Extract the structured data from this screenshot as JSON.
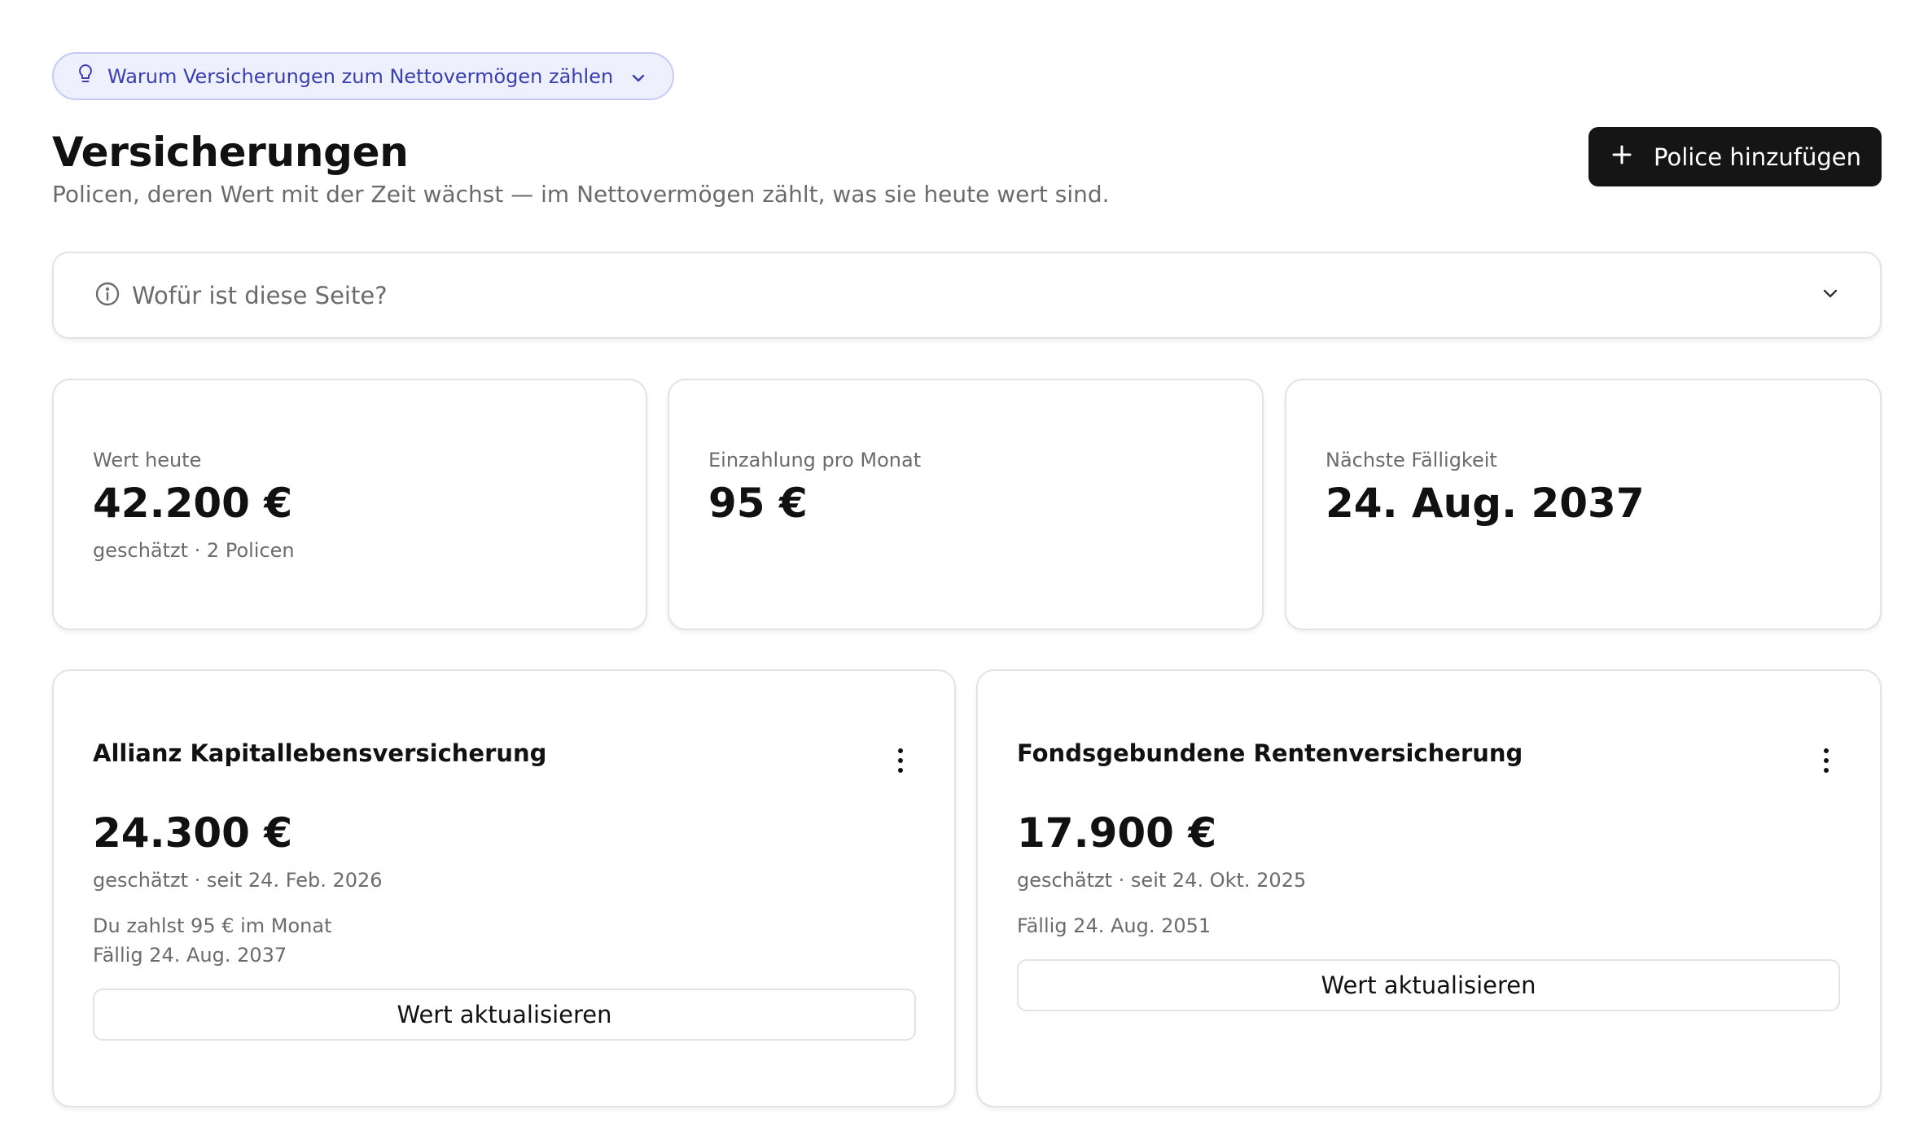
{
  "hint": {
    "label": "Warum Versicherungen zum Nettovermögen zählen",
    "icon": "lightbulb-icon"
  },
  "header": {
    "title": "Versicherungen",
    "subtitle": "Policen, deren Wert mit der Zeit wächst — im Nettovermögen zählt, was sie heute wert sind.",
    "add_button_label": "Police hinzufügen"
  },
  "info": {
    "question": "Wofür ist diese Seite?"
  },
  "stats": [
    {
      "label": "Wert heute",
      "value": "42.200 €",
      "sub": "geschätzt · 2 Policen"
    },
    {
      "label": "Einzahlung pro Monat",
      "value": "95 €",
      "sub": ""
    },
    {
      "label": "Nächste Fälligkeit",
      "value": "24. Aug. 2037",
      "sub": ""
    }
  ],
  "policies": [
    {
      "name": "Allianz Kapitallebensversicherung",
      "value": "24.300 €",
      "meta": "geschätzt · seit 24. Feb. 2026",
      "payment": "Du zahlst 95 € im Monat",
      "due": "Fällig 24. Aug. 2037",
      "button": "Wert aktualisieren"
    },
    {
      "name": "Fondsgebundene Rentenversicherung",
      "value": "17.900 €",
      "meta": "geschätzt · seit 24. Okt. 2025",
      "due": "Fällig 24. Aug. 2051",
      "button": "Wert aktualisieren"
    }
  ],
  "colors": {
    "accent": "#3a3fb0",
    "accent_bg": "#eef0fe",
    "primary_button": "#151515",
    "muted_text": "#6b6b6b"
  }
}
